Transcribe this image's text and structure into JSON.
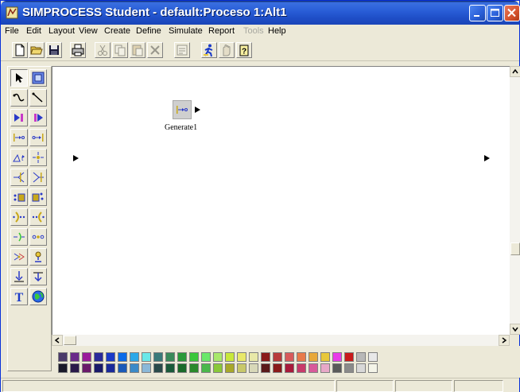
{
  "window": {
    "title": "SIMPROCESS Student - default:Proceso 1:Alt1"
  },
  "menu": [
    {
      "label": "File",
      "enabled": true
    },
    {
      "label": "Edit",
      "enabled": true
    },
    {
      "label": "Layout",
      "enabled": true
    },
    {
      "label": "View",
      "enabled": true
    },
    {
      "label": "Create",
      "enabled": true
    },
    {
      "label": "Define",
      "enabled": true
    },
    {
      "label": "Simulate",
      "enabled": true
    },
    {
      "label": "Report",
      "enabled": true
    },
    {
      "label": "Tools",
      "enabled": false
    },
    {
      "label": "Help",
      "enabled": true
    }
  ],
  "toolbar": [
    {
      "icon": "new-document-icon",
      "enabled": true
    },
    {
      "icon": "open-folder-icon",
      "enabled": true
    },
    {
      "icon": "save-disk-icon",
      "enabled": true
    },
    {
      "icon": "print-icon",
      "enabled": true
    },
    {
      "icon": "cut-icon",
      "enabled": false
    },
    {
      "icon": "copy-icon",
      "enabled": false
    },
    {
      "icon": "paste-icon",
      "enabled": false
    },
    {
      "icon": "delete-icon",
      "enabled": false
    },
    {
      "icon": "properties-icon",
      "enabled": false
    },
    {
      "icon": "run-simulation-icon",
      "enabled": true
    },
    {
      "icon": "stop-simulation-icon",
      "enabled": false
    },
    {
      "icon": "help-icon",
      "enabled": true
    }
  ],
  "palette": [
    [
      "select-arrow-icon",
      "zoom-select-icon"
    ],
    [
      "curved-connector-icon",
      "straight-connector-icon"
    ],
    [
      "start-icon",
      "end-icon"
    ],
    [
      "generate-icon",
      "dispose-icon"
    ],
    [
      "delay-icon",
      "branch-icon"
    ],
    [
      "split-icon",
      "join-icon"
    ],
    [
      "assemble-icon",
      "replicate-icon"
    ],
    [
      "batch-icon",
      "unbatch-icon"
    ],
    [
      "transform-icon",
      "merge-icon"
    ],
    [
      "gate-icon",
      "assign-icon"
    ],
    [
      "transfer-icon",
      "synchronize-icon"
    ],
    [
      "resource-in-icon",
      "resource-out-icon"
    ],
    [
      "text-tool-icon",
      "globe-icon"
    ]
  ],
  "canvas": {
    "node_label": "Generate1"
  },
  "colors": {
    "row1": [
      "#4a3a6a",
      "#6a2a8a",
      "#9a1a9a",
      "#2a2a9a",
      "#1a3ac8",
      "#0a6ae8",
      "#2aa8e8",
      "#6ae8e8",
      "#3a7a7a",
      "#3a8a5a",
      "#2a9a3a",
      "#3ac83a",
      "#6ae86a",
      "#a8e86a",
      "#c8e83a",
      "#e8e86a",
      "#e8e8a8",
      "#8a1a1a",
      "#b83a3a",
      "#d85a5a",
      "#e87a4a",
      "#e8a83a",
      "#e8c83a",
      "#e83ae8",
      "#c81a1a",
      "#b8b8b8",
      "#e8e8e8"
    ],
    "row2": [
      "#1a1a2a",
      "#2a1a4a",
      "#6a1a6a",
      "#1a1a6a",
      "#1a2a9a",
      "#1a5ab8",
      "#3a8ac8",
      "#8ab8d8",
      "#2a4a4a",
      "#1a5a3a",
      "#1a6a2a",
      "#2a8a2a",
      "#4ab84a",
      "#8ac83a",
      "#a8a82a",
      "#c8c86a",
      "#d8d8b8",
      "#5a1a1a",
      "#8a1a1a",
      "#a81a3a",
      "#c83a6a",
      "#d85a9a",
      "#e8a8c8",
      "#5a5a5a",
      "#8a8a8a",
      "#d8d8d8",
      "#f4f4e8"
    ]
  }
}
